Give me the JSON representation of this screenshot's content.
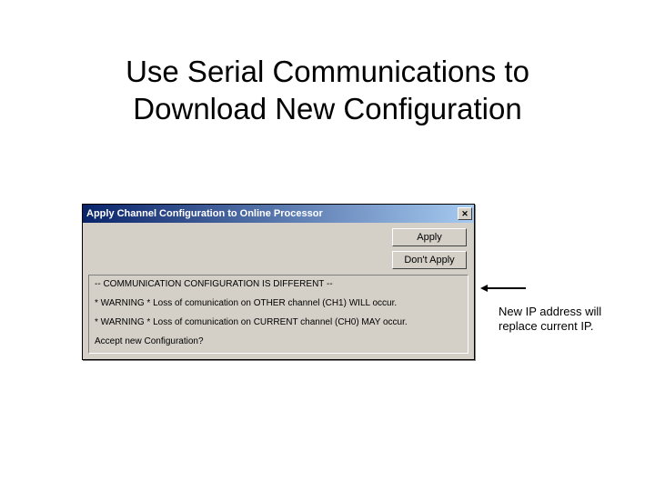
{
  "slide": {
    "title_line1": "Use Serial Communications to",
    "title_line2": "Download New Configuration"
  },
  "dialog": {
    "title": "Apply Channel Configuration to Online Processor",
    "apply_label": "Apply",
    "dont_apply_label": "Don't Apply",
    "messages": {
      "line1": "-- COMMUNICATION CONFIGURATION IS DIFFERENT --",
      "line2": "* WARNING * Loss of comunication on OTHER channel (CH1) WILL occur.",
      "line3": "* WARNING * Loss of comunication on CURRENT channel (CH0) MAY occur.",
      "line4": "Accept new Configuration?"
    },
    "close_glyph": "✕"
  },
  "annotation": {
    "text_line1": "New IP address will",
    "text_line2": "replace current IP."
  }
}
